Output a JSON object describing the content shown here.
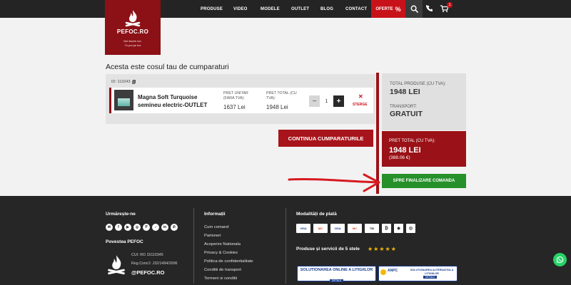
{
  "header": {
    "logo": {
      "brand": "PEFOC.RO",
      "slogan_line1": "Noi facem foc.",
      "slogan_line2": "Tu pui pe foc"
    },
    "nav": [
      "PRODUSE",
      "VIDEO",
      "MODELE",
      "OUTLET",
      "BLOG",
      "CONTACT"
    ],
    "oferte_label": "OFERTE",
    "oferte_symbol": "%",
    "cart_count": "1"
  },
  "cart": {
    "title": "Acesta este cosul tau de cumparaturi",
    "id_label": "ID: 113243",
    "item": {
      "name": "Magna Soft Turquoise semineu electric-OUTLET",
      "unit_label": "PRET UNITAR (FARA TVA):",
      "unit_value": "1637 Lei",
      "total_label": "PRET TOTAL (CU TVA):",
      "total_value": "1948 Lei",
      "quantity": "1",
      "minus": "−",
      "plus": "+",
      "delete_x": "✕",
      "delete_label": "STERGE"
    },
    "continue_label": "CONTINUA CUMPARATURILE"
  },
  "summary": {
    "products_label": "TOTAL PRODUSE (CU TVA):",
    "products_value": "1948 LEI",
    "transport_label": "TRANSPORT:",
    "transport_value": "GRATUIT",
    "grand_label": "PRET TOTAL (CU TVA):",
    "grand_value": "1948 LEI",
    "grand_eur": "(388.06 €)",
    "checkout_label": "SPRE FINALIZARE COMANDA"
  },
  "footer": {
    "follow_title": "Urmărește-ne",
    "socials": [
      "✉",
      "f",
      "▶",
      "◎",
      "P",
      "♪",
      "in",
      "✆"
    ],
    "story_title": "Povestea PEFOC",
    "cui": "CUI: RO 15110345",
    "regcom": "Reg.Com/J: J32/1494/2006",
    "brand": "@PEFOC.RO",
    "info_title": "Informații",
    "info_links": [
      "Cum comand",
      "Parteneri",
      "Acoperire Nationala",
      "Privacy & Cookies",
      "Politica de confidentialitate",
      "Conditii de transport",
      "Termeni si conditii"
    ],
    "payment_title": "Modalități de plată",
    "payments": [
      "VISA",
      "MC",
      "VISA",
      "MC",
      "TBI",
      "₿",
      "◆",
      "◎"
    ],
    "rating_title": "Produse și servicii de 5 stele",
    "stars": "★★★★★",
    "badge1_title": "SOLUTIONAREA ONLINE A LITIGIILOR",
    "badge1_detail": "DETALII",
    "badge2_org": "ANPC",
    "badge2_title": "SOLUTIONAREA ALTERNATIVA A LITIGIILOR",
    "badge2_detail": "DETALII"
  },
  "colors": {
    "brand_red": "#8b1116",
    "checkout_green": "#26902a",
    "footer_bg": "#262626"
  }
}
